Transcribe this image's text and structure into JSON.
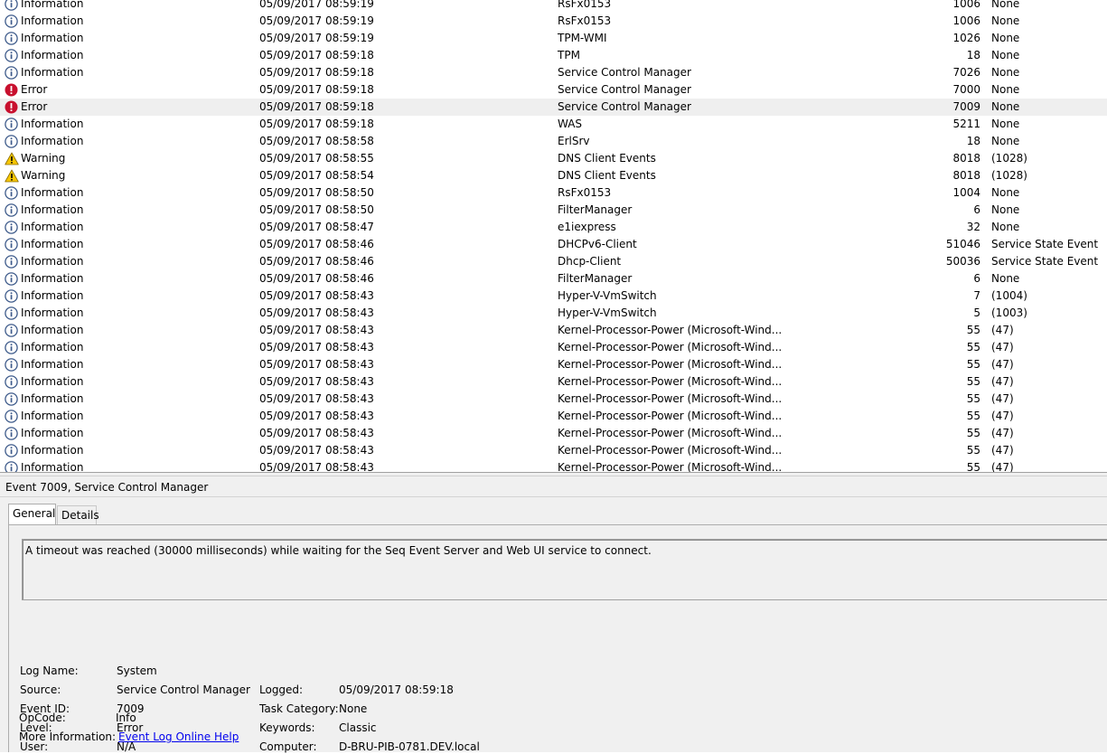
{
  "events": [
    {
      "level": "Information",
      "icon": "info-icon",
      "date": "05/09/2017 08:59:19",
      "source": "RsFx0153",
      "id": "1006",
      "task": "None"
    },
    {
      "level": "Information",
      "icon": "info-icon",
      "date": "05/09/2017 08:59:19",
      "source": "RsFx0153",
      "id": "1006",
      "task": "None"
    },
    {
      "level": "Information",
      "icon": "info-icon",
      "date": "05/09/2017 08:59:19",
      "source": "TPM-WMI",
      "id": "1026",
      "task": "None"
    },
    {
      "level": "Information",
      "icon": "info-icon",
      "date": "05/09/2017 08:59:18",
      "source": "TPM",
      "id": "18",
      "task": "None"
    },
    {
      "level": "Information",
      "icon": "info-icon",
      "date": "05/09/2017 08:59:18",
      "source": "Service Control Manager",
      "id": "7026",
      "task": "None"
    },
    {
      "level": "Error",
      "icon": "error-icon",
      "date": "05/09/2017 08:59:18",
      "source": "Service Control Manager",
      "id": "7000",
      "task": "None"
    },
    {
      "level": "Error",
      "icon": "error-icon",
      "date": "05/09/2017 08:59:18",
      "source": "Service Control Manager",
      "id": "7009",
      "task": "None",
      "selected": true
    },
    {
      "level": "Information",
      "icon": "info-icon",
      "date": "05/09/2017 08:59:18",
      "source": "WAS",
      "id": "5211",
      "task": "None"
    },
    {
      "level": "Information",
      "icon": "info-icon",
      "date": "05/09/2017 08:58:58",
      "source": "ErlSrv",
      "id": "18",
      "task": "None"
    },
    {
      "level": "Warning",
      "icon": "warning-icon",
      "date": "05/09/2017 08:58:55",
      "source": "DNS Client Events",
      "id": "8018",
      "task": "(1028)"
    },
    {
      "level": "Warning",
      "icon": "warning-icon",
      "date": "05/09/2017 08:58:54",
      "source": "DNS Client Events",
      "id": "8018",
      "task": "(1028)"
    },
    {
      "level": "Information",
      "icon": "info-icon",
      "date": "05/09/2017 08:58:50",
      "source": "RsFx0153",
      "id": "1004",
      "task": "None"
    },
    {
      "level": "Information",
      "icon": "info-icon",
      "date": "05/09/2017 08:58:50",
      "source": "FilterManager",
      "id": "6",
      "task": "None"
    },
    {
      "level": "Information",
      "icon": "info-icon",
      "date": "05/09/2017 08:58:47",
      "source": "e1iexpress",
      "id": "32",
      "task": "None"
    },
    {
      "level": "Information",
      "icon": "info-icon",
      "date": "05/09/2017 08:58:46",
      "source": "DHCPv6-Client",
      "id": "51046",
      "task": "Service State Event"
    },
    {
      "level": "Information",
      "icon": "info-icon",
      "date": "05/09/2017 08:58:46",
      "source": "Dhcp-Client",
      "id": "50036",
      "task": "Service State Event"
    },
    {
      "level": "Information",
      "icon": "info-icon",
      "date": "05/09/2017 08:58:46",
      "source": "FilterManager",
      "id": "6",
      "task": "None"
    },
    {
      "level": "Information",
      "icon": "info-icon",
      "date": "05/09/2017 08:58:43",
      "source": "Hyper-V-VmSwitch",
      "id": "7",
      "task": "(1004)"
    },
    {
      "level": "Information",
      "icon": "info-icon",
      "date": "05/09/2017 08:58:43",
      "source": "Hyper-V-VmSwitch",
      "id": "5",
      "task": "(1003)"
    },
    {
      "level": "Information",
      "icon": "info-icon",
      "date": "05/09/2017 08:58:43",
      "source": "Kernel-Processor-Power (Microsoft-Wind...",
      "id": "55",
      "task": "(47)"
    },
    {
      "level": "Information",
      "icon": "info-icon",
      "date": "05/09/2017 08:58:43",
      "source": "Kernel-Processor-Power (Microsoft-Wind...",
      "id": "55",
      "task": "(47)"
    },
    {
      "level": "Information",
      "icon": "info-icon",
      "date": "05/09/2017 08:58:43",
      "source": "Kernel-Processor-Power (Microsoft-Wind...",
      "id": "55",
      "task": "(47)"
    },
    {
      "level": "Information",
      "icon": "info-icon",
      "date": "05/09/2017 08:58:43",
      "source": "Kernel-Processor-Power (Microsoft-Wind...",
      "id": "55",
      "task": "(47)"
    },
    {
      "level": "Information",
      "icon": "info-icon",
      "date": "05/09/2017 08:58:43",
      "source": "Kernel-Processor-Power (Microsoft-Wind...",
      "id": "55",
      "task": "(47)"
    },
    {
      "level": "Information",
      "icon": "info-icon",
      "date": "05/09/2017 08:58:43",
      "source": "Kernel-Processor-Power (Microsoft-Wind...",
      "id": "55",
      "task": "(47)"
    },
    {
      "level": "Information",
      "icon": "info-icon",
      "date": "05/09/2017 08:58:43",
      "source": "Kernel-Processor-Power (Microsoft-Wind...",
      "id": "55",
      "task": "(47)"
    },
    {
      "level": "Information",
      "icon": "info-icon",
      "date": "05/09/2017 08:58:43",
      "source": "Kernel-Processor-Power (Microsoft-Wind...",
      "id": "55",
      "task": "(47)"
    },
    {
      "level": "Information",
      "icon": "info-icon",
      "date": "05/09/2017 08:58:43",
      "source": "Kernel-Processor-Power (Microsoft-Wind...",
      "id": "55",
      "task": "(47)"
    }
  ],
  "colors": {
    "info": "#3d5a8a",
    "error": "#c8102e",
    "warning": "#f7c600",
    "selected_row": "#efefef",
    "link": "#0000ee"
  },
  "detail": {
    "title": "Event 7009, Service Control Manager",
    "tabs": {
      "general": "General",
      "details": "Details"
    },
    "description": "A timeout was reached (30000 milliseconds) while waiting for the Seq Event Server and Web UI service to connect.",
    "labels": {
      "log_name": "Log Name:",
      "source": "Source:",
      "event_id": "Event ID:",
      "level": "Level:",
      "user": "User:",
      "opcode": "OpCode:",
      "more_info": "More Information:",
      "logged": "Logged:",
      "task_category": "Task Category:",
      "keywords": "Keywords:",
      "computer": "Computer:"
    },
    "values": {
      "log_name": "System",
      "source": "Service Control Manager",
      "event_id": "7009",
      "level": "Error",
      "user": "N/A",
      "opcode": "Info",
      "more_info_link": "Event Log Online Help",
      "logged": "05/09/2017 08:59:18",
      "task_category": "None",
      "keywords": "Classic",
      "computer": "D-BRU-PIB-0781.DEV.local"
    }
  }
}
